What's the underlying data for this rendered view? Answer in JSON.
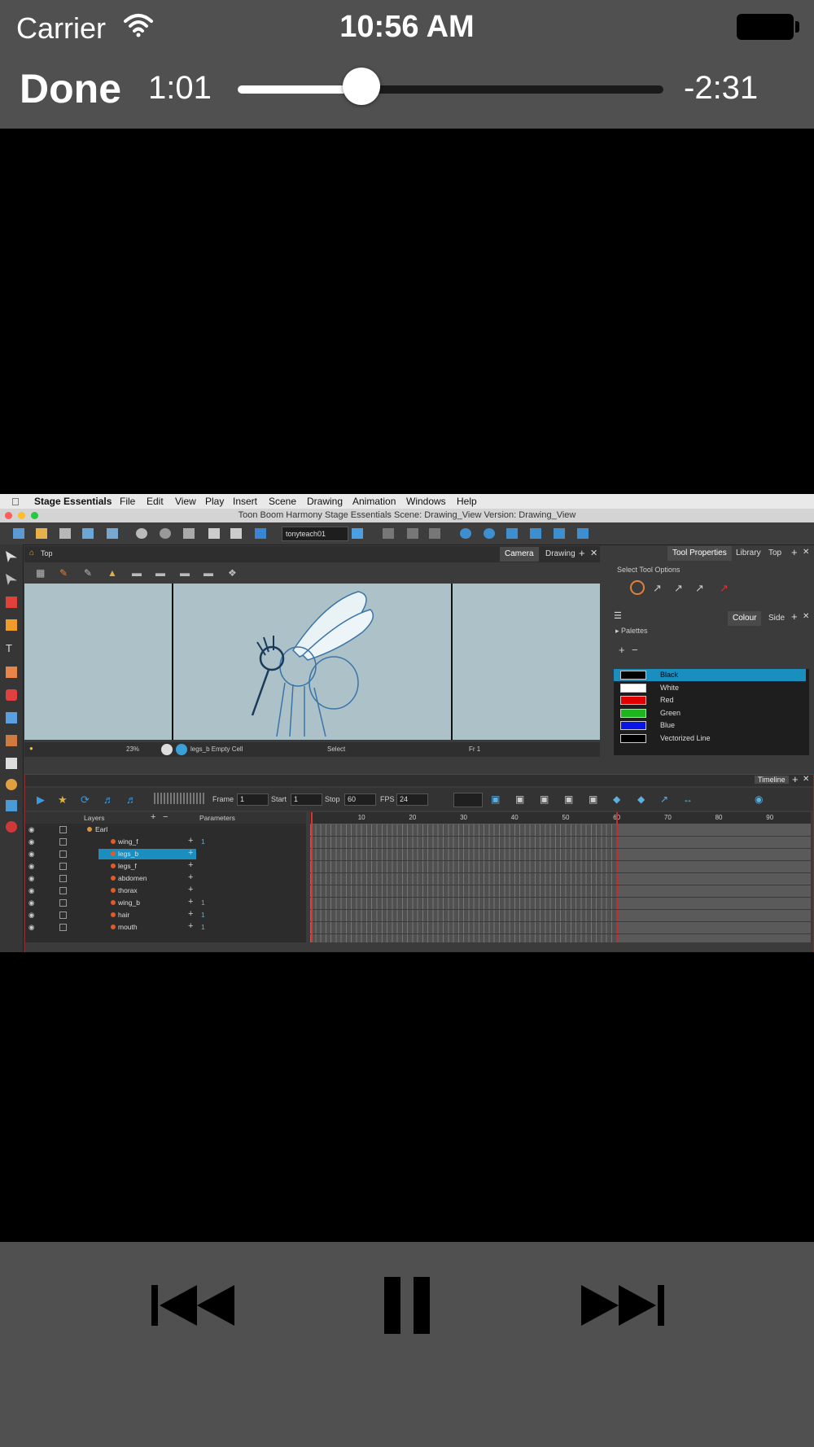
{
  "status_bar": {
    "carrier": "Carrier",
    "time": "10:56 AM",
    "wifi_icon": "wifi-icon",
    "battery_icon": "battery-icon"
  },
  "player": {
    "done_label": "Done",
    "elapsed": "1:01",
    "remaining": "-2:31",
    "progress_fraction": 0.29,
    "controls": {
      "previous_icon": "skip-back-icon",
      "pause_icon": "pause-icon",
      "next_icon": "skip-forward-icon"
    }
  },
  "video": {
    "mac_menu": [
      "Stage Essentials",
      "File",
      "Edit",
      "View",
      "Play",
      "Insert",
      "Scene",
      "Drawing",
      "Animation",
      "Windows",
      "Help"
    ],
    "window_title": "Toon Boom Harmony Stage Essentials Scene: Drawing_View Version: Drawing_View",
    "toolbar_user": "tonyteach01",
    "view_panel": {
      "breadcrumb": "Top",
      "tabs": [
        "Camera",
        "Drawing"
      ],
      "status_zoom": "23%",
      "status_cell": "legs_b Empty Cell",
      "status_tool": "Select",
      "status_frame": "Fr 1"
    },
    "right_panel": {
      "tabs_top": [
        "Tool Properties",
        "Library",
        "Top"
      ],
      "tool_options_label": "Select Tool Options",
      "tabs_bottom": [
        "Colour",
        "Side"
      ],
      "palettes_label": "Palettes",
      "palette_colors": [
        {
          "name": "Black",
          "color": "#000000",
          "selected": true
        },
        {
          "name": "White",
          "color": "#ffffff",
          "selected": false
        },
        {
          "name": "Red",
          "color": "#e00000",
          "selected": false
        },
        {
          "name": "Green",
          "color": "#1fb51f",
          "selected": false
        },
        {
          "name": "Blue",
          "color": "#0a14e6",
          "selected": false
        },
        {
          "name": "Vectorized Line",
          "color": "#000000",
          "selected": false
        }
      ]
    },
    "timeline": {
      "title": "Timeline",
      "frame_label": "Frame",
      "frame_value": "1",
      "start_label": "Start",
      "start_value": "1",
      "stop_label": "Stop",
      "stop_value": "60",
      "fps_label": "FPS",
      "fps_value": "24",
      "layers_header": "Layers",
      "parameters_header": "Parameters",
      "ruler_ticks": [
        "10",
        "20",
        "30",
        "40",
        "50",
        "60",
        "70",
        "80",
        "90"
      ],
      "layers": [
        {
          "name": "Earl",
          "group": true,
          "param": ""
        },
        {
          "name": "wing_f",
          "group": false,
          "param": "1"
        },
        {
          "name": "legs_b",
          "group": false,
          "param": "",
          "selected": true
        },
        {
          "name": "legs_f",
          "group": false,
          "param": ""
        },
        {
          "name": "abdomen",
          "group": false,
          "param": ""
        },
        {
          "name": "thorax",
          "group": false,
          "param": ""
        },
        {
          "name": "wing_b",
          "group": false,
          "param": "1"
        },
        {
          "name": "hair",
          "group": false,
          "param": "1"
        },
        {
          "name": "mouth",
          "group": false,
          "param": "1"
        }
      ]
    }
  },
  "colors": {
    "ios_bar": "#505050",
    "selection_blue": "#1a8fbf"
  }
}
